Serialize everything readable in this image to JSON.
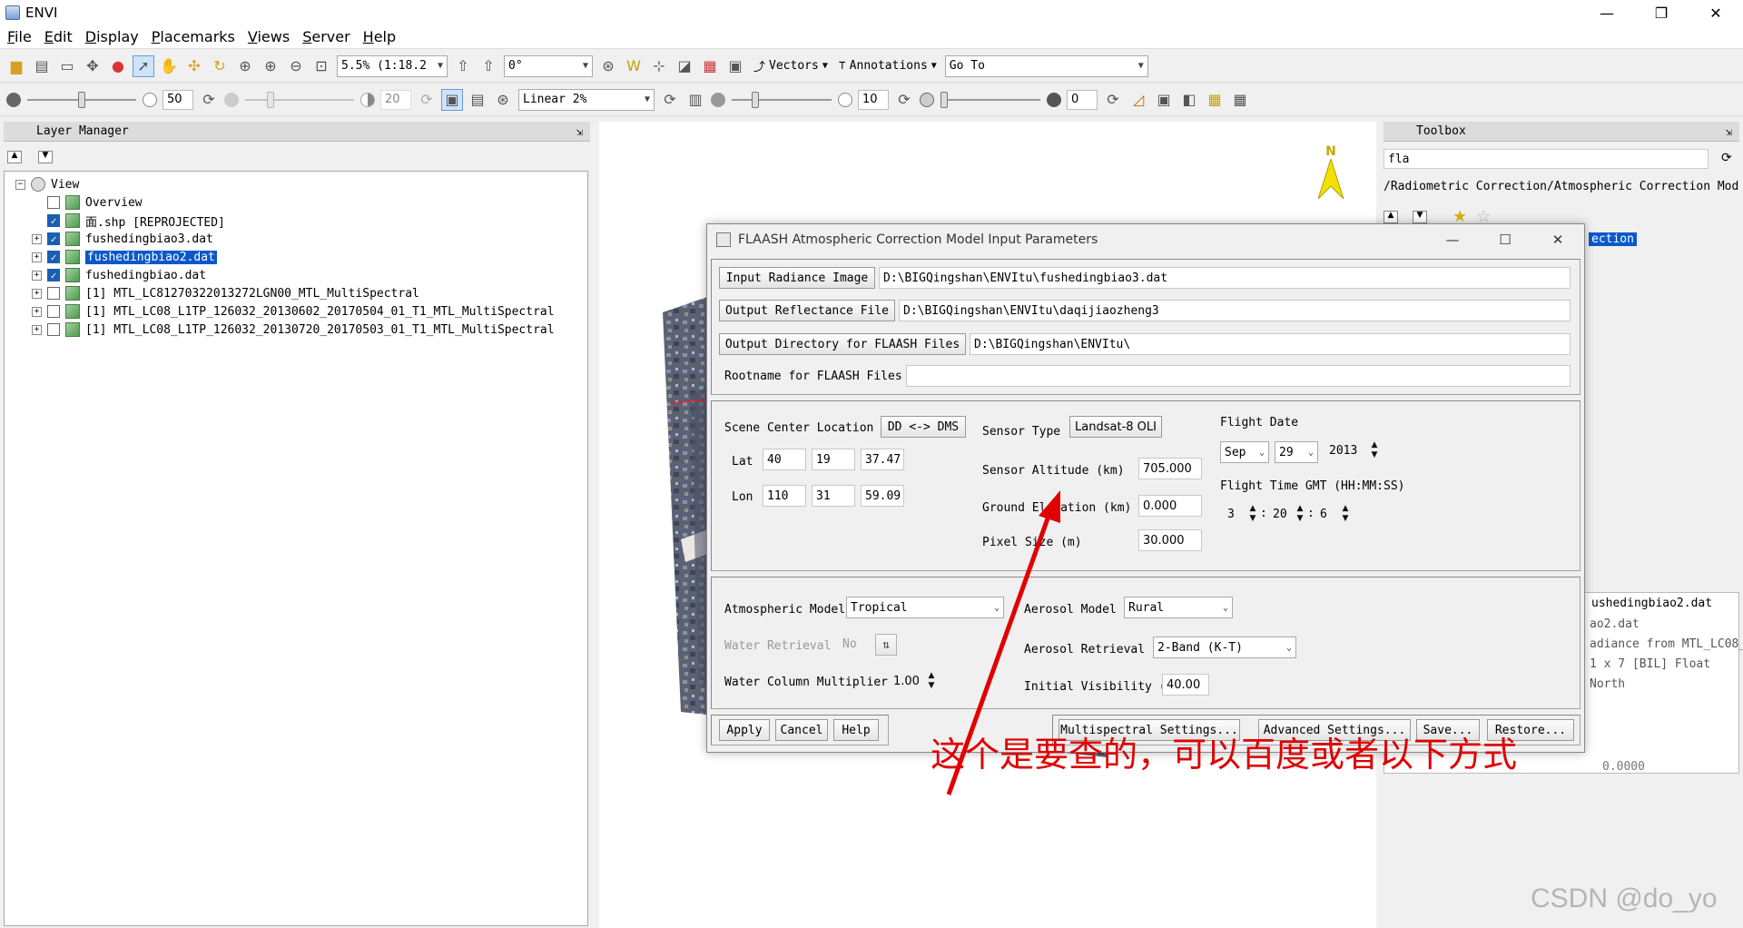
{
  "app": {
    "title": "ENVI"
  },
  "window_controls": {
    "minimize": "—",
    "maximize": "❐",
    "close": "✕"
  },
  "menubar": [
    {
      "accel": "F",
      "rest": "ile"
    },
    {
      "accel": "E",
      "rest": "dit"
    },
    {
      "accel": "D",
      "rest": "isplay"
    },
    {
      "accel": "P",
      "rest": "lacemarks"
    },
    {
      "accel": "V",
      "rest": "iews"
    },
    {
      "accel": "S",
      "rest": "erver"
    },
    {
      "accel": "H",
      "rest": "elp"
    }
  ],
  "toolbar1": {
    "zoom_value": "5.5% (1:18.2",
    "rotation_value": "0°",
    "vectors_label": "Vectors",
    "annotations_label": "Annotations",
    "goto_value": "Go To"
  },
  "toolbar2": {
    "brightness": "50",
    "brightness_level": 0.5,
    "contrast": "20",
    "stretch_value": "Linear 2%",
    "sharpen": "10",
    "transparency": "0"
  },
  "layer_manager": {
    "title": "Layer Manager",
    "root": "View",
    "items": [
      {
        "label": "Overview",
        "checked": false,
        "expander": false
      },
      {
        "label": "面.shp [REPROJECTED]",
        "checked": true,
        "expander": false
      },
      {
        "label": "fushedingbiao3.dat",
        "checked": true,
        "expander": true
      },
      {
        "label": "fushedingbiao2.dat",
        "checked": true,
        "expander": true,
        "selected": true
      },
      {
        "label": "fushedingbiao.dat",
        "checked": true,
        "expander": true
      },
      {
        "label": "[1] MTL_LC81270322013272LGN00_MTL_MultiSpectral",
        "checked": false,
        "expander": true
      },
      {
        "label": "[1] MTL_LC08_L1TP_126032_20130602_20170504_01_T1_MTL_MultiSpectral",
        "checked": false,
        "expander": true
      },
      {
        "label": "[1] MTL_LC08_L1TP_126032_20130720_20170503_01_T1_MTL_MultiSpectral",
        "checked": false,
        "expander": true
      }
    ]
  },
  "view": {
    "north_label": "N"
  },
  "toolbox": {
    "title": "Toolbox",
    "search": "fla",
    "path": "/Radiometric Correction/Atmospheric Correction Modu",
    "selected_partial": "ection"
  },
  "info_panel": {
    "header": "ushedingbiao2.dat",
    "lines": [
      "ao2.dat",
      "adiance from MTL_LC08_",
      "1 x 7 [BIL] Float",
      "North"
    ],
    "footer": "0.0000"
  },
  "dialog": {
    "title": "FLAASH Atmospheric Correction Model Input Parameters",
    "input_radiance_button": "Input Radiance Image",
    "input_radiance_path": "D:\\BIGQingshan\\ENVItu\\fushedingbiao3.dat",
    "output_reflectance_button": "Output Reflectance File",
    "output_reflectance_path": "D:\\BIGQingshan\\ENVItu\\daqijiaozheng3",
    "output_dir_button": "Output Directory for FLAASH Files",
    "output_dir_path": "D:\\BIGQingshan\\ENVItu\\",
    "rootname_label": "Rootname for FLAASH Files",
    "rootname_value": "",
    "scene_center_label": "Scene Center Location",
    "dd_dms_button": "DD <-> DMS",
    "lat_label": "Lat",
    "lat": [
      "40",
      "19",
      "37.47"
    ],
    "lon_label": "Lon",
    "lon": [
      "110",
      "31",
      "59.09"
    ],
    "sensor_type_label": "Sensor Type",
    "sensor_type": "Landsat-8 OLI",
    "sensor_altitude_label": "Sensor Altitude (km)",
    "sensor_altitude": "705.000",
    "ground_elevation_label": "Ground Elevation (km)",
    "ground_elevation": "0.000",
    "pixel_size_label": "Pixel Size (m)",
    "pixel_size": "30.000",
    "flight_date_label": "Flight Date",
    "flight_month": "Sep",
    "flight_day": "29",
    "flight_year": "2013",
    "flight_time_label": "Flight Time GMT (HH:MM:SS)",
    "flight_hh": "3",
    "flight_mm": "20",
    "flight_ss": "6",
    "time_sep": ":",
    "atm_model_label": "Atmospheric Model",
    "atm_model": "Tropical",
    "aerosol_model_label": "Aerosol Model",
    "aerosol_model": "Rural",
    "water_retrieval_label": "Water Retrieval",
    "water_retrieval": "No",
    "aerosol_retrieval_label": "Aerosol Retrieval",
    "aerosol_retrieval": "2-Band (K-T)",
    "water_column_label": "Water Column Multiplier",
    "water_column": "1.00",
    "initial_visibility_label": "Initial Visibility (km)",
    "initial_visibility": "40.00",
    "apply": "Apply",
    "cancel": "Cancel",
    "help": "Help",
    "multispectral": "Multispectral Settings...",
    "advanced": "Advanced Settings...",
    "save": "Save...",
    "restore": "Restore..."
  },
  "annotation_text": "这个是要查的，可以百度或者以下方式",
  "annotation_color": "#e00000",
  "watermark": "CSDN @do_yo"
}
